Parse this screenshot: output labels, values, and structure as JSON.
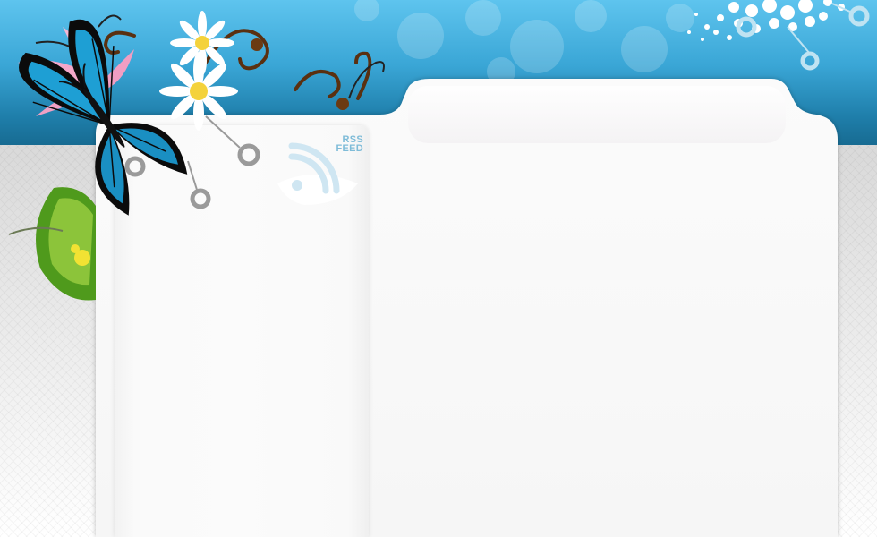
{
  "rss": {
    "line1": "RSS",
    "line2": "FEED"
  },
  "colors": {
    "header_top": "#5ec4ee",
    "header_bottom": "#176b92",
    "butterfly_blue": "#1e9fd4",
    "panel": "#f7f7f7",
    "rss_text": "#7fbcd8"
  },
  "icons": {
    "butterfly": "butterfly-icon",
    "rss": "rss-feed-icon"
  }
}
